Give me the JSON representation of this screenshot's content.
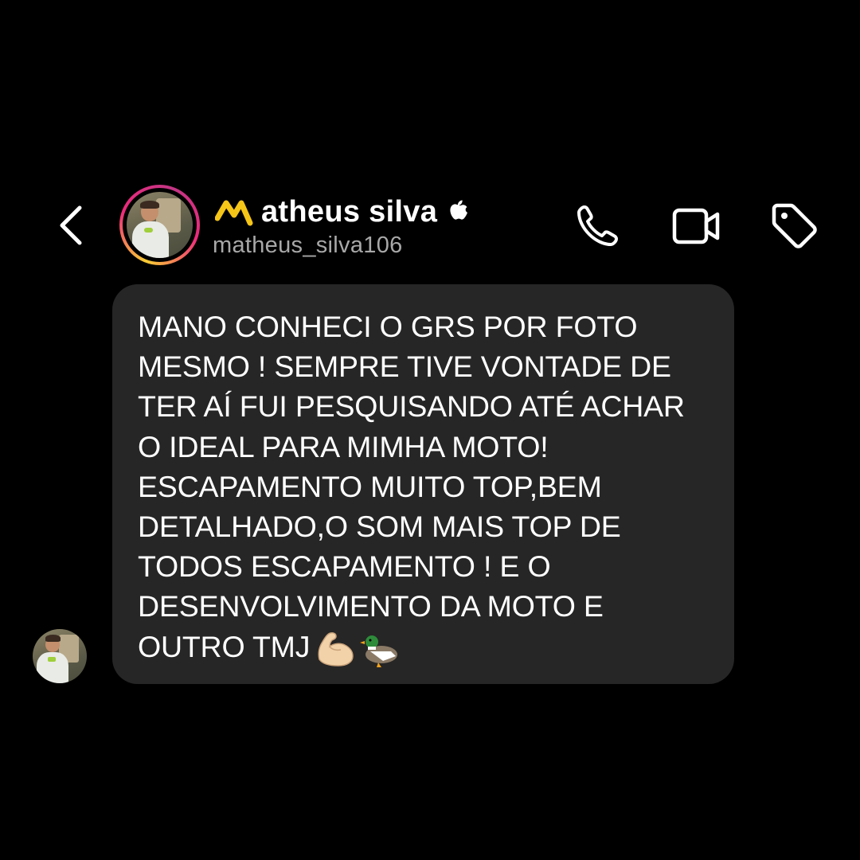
{
  "header": {
    "back_icon": "chevron-left-icon",
    "display_name": "atheus silva",
    "display_name_logo": "M",
    "badge_icon": "apple-logo-icon",
    "username": "matheus_silva106",
    "actions": [
      {
        "icon": "phone-icon",
        "label": "Voice call"
      },
      {
        "icon": "video-camera-icon",
        "label": "Video call"
      },
      {
        "icon": "tag-icon",
        "label": "Label"
      }
    ]
  },
  "message": {
    "text": "MANO CONHECI O GRS POR FOTO\nMESMO ! SEMPRE TIVE VONTADE DE\nTER AÍ FUI PESQUISANDO ATÉ ACHAR\nO IDEAL PARA MIMHA MOTO!\nESCAPAMENTO MUITO TOP,BEM\nDETALHADO,O SOM MAIS TOP DE\nTODOS ESCAPAMENTO ! E O\nDESENVOLVIMENTO DA MOTO E\nOUTRO TMJ",
    "emojis": [
      "flexed-biceps-emoji",
      "duck-emoji"
    ]
  },
  "colors": {
    "background": "#000000",
    "bubble": "#262626",
    "username": "#a8a8a8",
    "logo_yellow": "#f5c518",
    "story_ring_start": "#f9ce34",
    "story_ring_end": "#ee2a7b"
  }
}
